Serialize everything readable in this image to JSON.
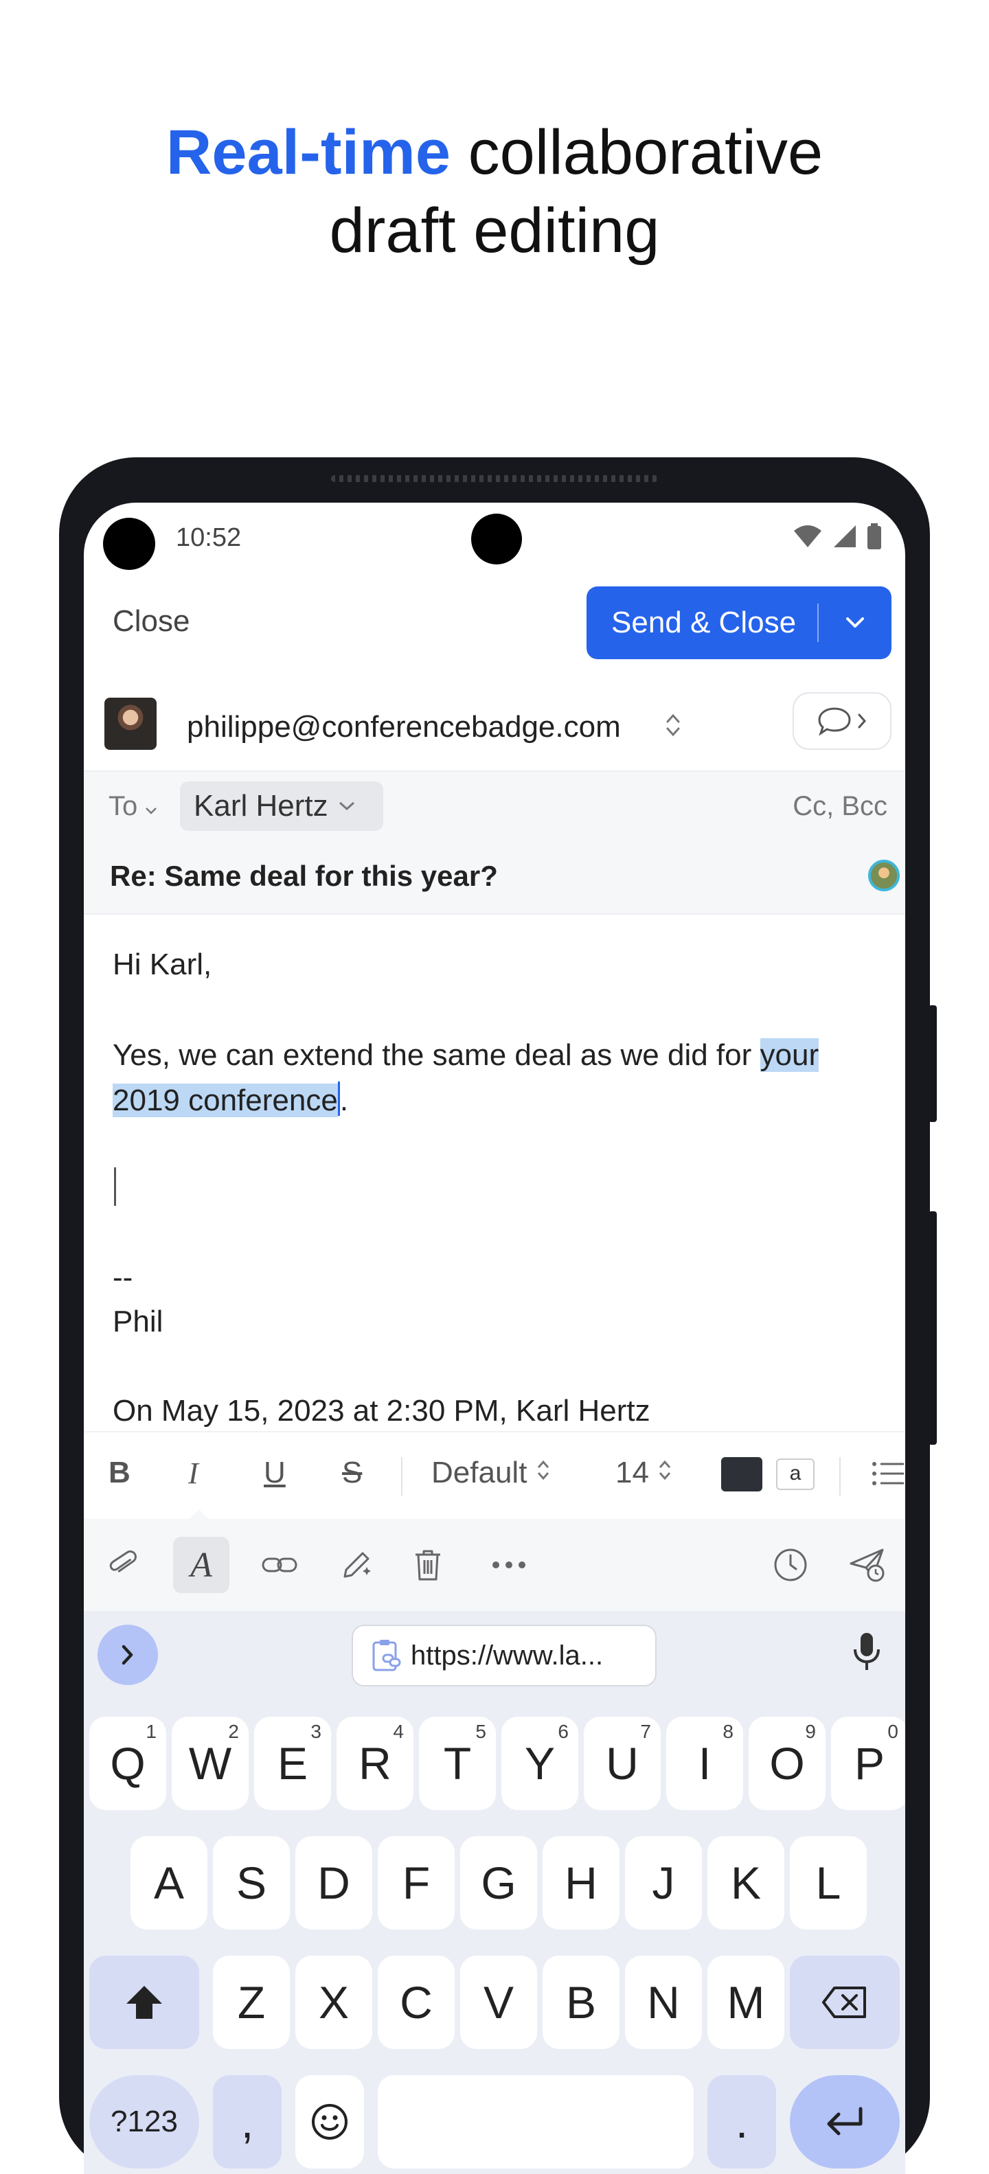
{
  "headline": {
    "accent": "Real-time",
    "rest_line1": " collaborative",
    "line2": "draft editing"
  },
  "status_bar": {
    "time": "10:52"
  },
  "header": {
    "close_label": "Close",
    "send_label": "Send & Close"
  },
  "from": {
    "email": "philippe@conferencebadge.com"
  },
  "recipients": {
    "to_label": "To",
    "to_chip": "Karl Hertz",
    "cc_bcc_label": "Cc, Bcc"
  },
  "subject": "Re: Same deal for this year?",
  "body": {
    "greeting": "Hi Karl,",
    "line1_plain": "Yes, we can extend the same deal as we did for ",
    "line1_selected": "your",
    "line2_selected": "2019 conference",
    "line2_after": ".",
    "sig_dash": "--",
    "sig_name": "Phil",
    "quote_header": "On May 15, 2023 at 2:30 PM, Karl Hertz"
  },
  "format_bar": {
    "bold": "B",
    "italic": "I",
    "underline": "U",
    "strike": "S",
    "font_family": "Default",
    "font_size": "14",
    "text_color": "#2d3036",
    "highlight_label": "a"
  },
  "toolbar": {
    "icons": [
      "paperclip-icon",
      "text-format-icon",
      "link-icon",
      "ai-pen-icon",
      "trash-icon",
      "more-icon",
      "schedule-clock-icon",
      "send-later-icon"
    ],
    "active": "text-format-icon"
  },
  "keyboard": {
    "clipboard_text": "https://www.la...",
    "row1": [
      {
        "k": "Q",
        "h": "1"
      },
      {
        "k": "W",
        "h": "2"
      },
      {
        "k": "E",
        "h": "3"
      },
      {
        "k": "R",
        "h": "4"
      },
      {
        "k": "T",
        "h": "5"
      },
      {
        "k": "Y",
        "h": "6"
      },
      {
        "k": "U",
        "h": "7"
      },
      {
        "k": "I",
        "h": "8"
      },
      {
        "k": "O",
        "h": "9"
      },
      {
        "k": "P",
        "h": "0"
      }
    ],
    "row2": [
      "A",
      "S",
      "D",
      "F",
      "G",
      "H",
      "J",
      "K",
      "L"
    ],
    "row3": [
      "Z",
      "X",
      "C",
      "V",
      "B",
      "N",
      "M"
    ],
    "symbols_label": "?123",
    "comma_label": ",",
    "period_label": "."
  },
  "colors": {
    "accent": "#2563eb",
    "selection": "#bcd8f5",
    "keyboard_bg": "#eceef6",
    "modifier_key": "#d7dcf5",
    "enter_key": "#b3c3f7"
  }
}
